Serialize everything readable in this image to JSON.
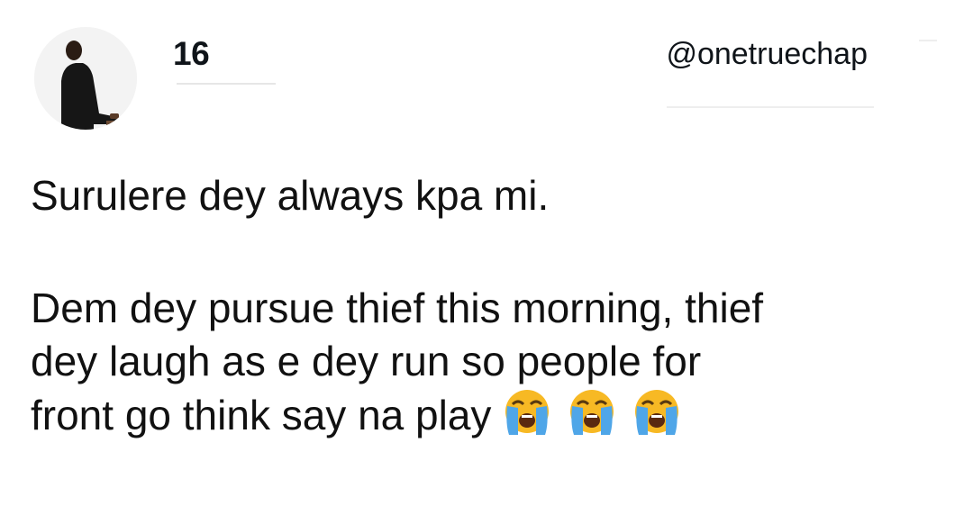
{
  "tweet": {
    "author_name": "16",
    "handle": "@onetruechap",
    "paragraphs": [
      "Surulere dey always kpa mi.",
      "Dem dey pursue thief this morning, thief",
      "dey laugh as e dey run so people for",
      "front go think say na play"
    ],
    "trailing_emojis": [
      "loudly-crying-face",
      "loudly-crying-face",
      "loudly-crying-face"
    ]
  },
  "colors": {
    "text": "#0f1419",
    "emoji_face": "#f7b924",
    "emoji_tears": "#4fa6e8"
  }
}
